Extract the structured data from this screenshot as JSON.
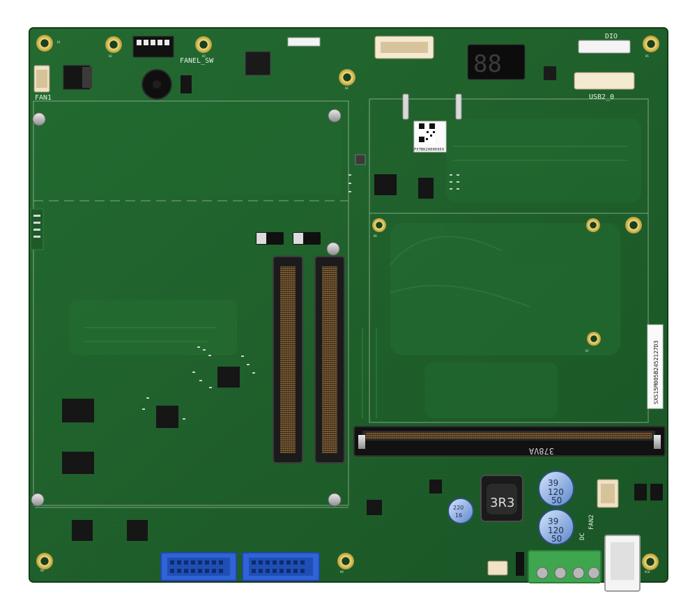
{
  "board": {
    "colors": {
      "pcb": "#1f5f2b",
      "pcb_dark": "#184d22",
      "pcb_light": "#2a7236",
      "silkscreen": "#e8f1e6",
      "gold": "#d8c25a",
      "usb_blue": "#2f63d6",
      "terminal_green": "#3fa54f"
    },
    "labels": {
      "fan1": "FAN1",
      "fanel_sw": "FANEL_SW",
      "dio": "DIO",
      "usb2": "USB2_0",
      "inductor": "3R3",
      "slot_code": "378VA",
      "serial_sticker": "SXS15M005B2452127D3",
      "qr_code_text": "FXTBK20006959",
      "fan2": "FAN2",
      "dc": "DC",
      "cap_top_a": "39",
      "cap_top_b": "120",
      "cap_top_c": "50",
      "cap_left_a": "220",
      "cap_left_b": "16"
    },
    "icons": {
      "mounting_hole": "mounting-hole-icon",
      "connector": "pin-header-icon",
      "capacitor": "electrolytic-capacitor-icon",
      "inductor": "inductor-icon",
      "buzzer": "buzzer-icon",
      "qr": "qr-code-icon"
    }
  }
}
